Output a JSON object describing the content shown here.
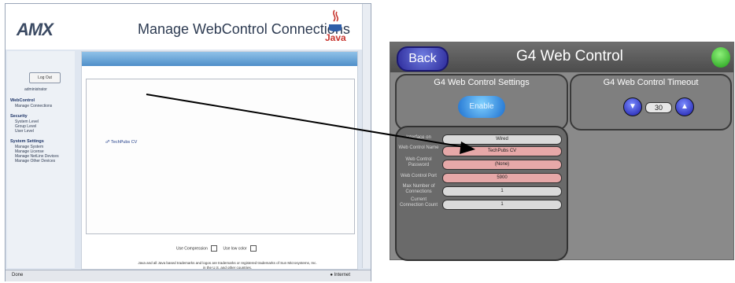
{
  "browser": {
    "logo": "AMX",
    "title": "Manage WebControl Connections",
    "java_label": "Java",
    "logout_label": "Log Out",
    "user": "administrator",
    "nav": [
      {
        "head": "WebControl",
        "items": [
          "Manage Connections"
        ]
      },
      {
        "head": "Security",
        "items": [
          "System Level",
          "Group Level",
          "User Level"
        ]
      },
      {
        "head": "System Settings",
        "items": [
          "Manage System",
          "Manage License",
          "Manage NetLinx Devices",
          "Manage Other Devices"
        ]
      }
    ],
    "connection_link": "TechPubs CV",
    "use_compression_label": "Use Compression",
    "use_low_color_label": "Use low color",
    "footer_note": "Java and all Java based trademarks and logos are trademarks or registered trademarks of Sun Microsystems, Inc. in the U.S. and other countries.",
    "status_left": "Done",
    "status_right": "Internet"
  },
  "panel": {
    "back_label": "Back",
    "title": "G4 Web Control",
    "settings_title": "G4 Web Control Settings",
    "enable_label": "Enable",
    "timeout_title": "G4 Web Control Timeout",
    "timeout_value": "30",
    "fields": [
      {
        "label": "Interface on",
        "value": "Wired",
        "style": "gray"
      },
      {
        "label": "Web Control Name",
        "value": "TechPubs CV",
        "style": "pink"
      },
      {
        "label": "Web Control Password",
        "value": "(None)",
        "style": "pink"
      },
      {
        "label": "Web Control Port",
        "value": "5900",
        "style": "pink"
      },
      {
        "label": "Max Number of Connections",
        "value": "1",
        "style": "gray"
      },
      {
        "label": "Current Connection Count",
        "value": "1",
        "style": "gray"
      }
    ]
  },
  "colors": {
    "back_button": "#2c2a9a",
    "enable_button": "#1d6fcf",
    "pink_field": "#e6a8a8",
    "gray_field": "#dadada",
    "panel_bg": "#8a8a8a"
  }
}
